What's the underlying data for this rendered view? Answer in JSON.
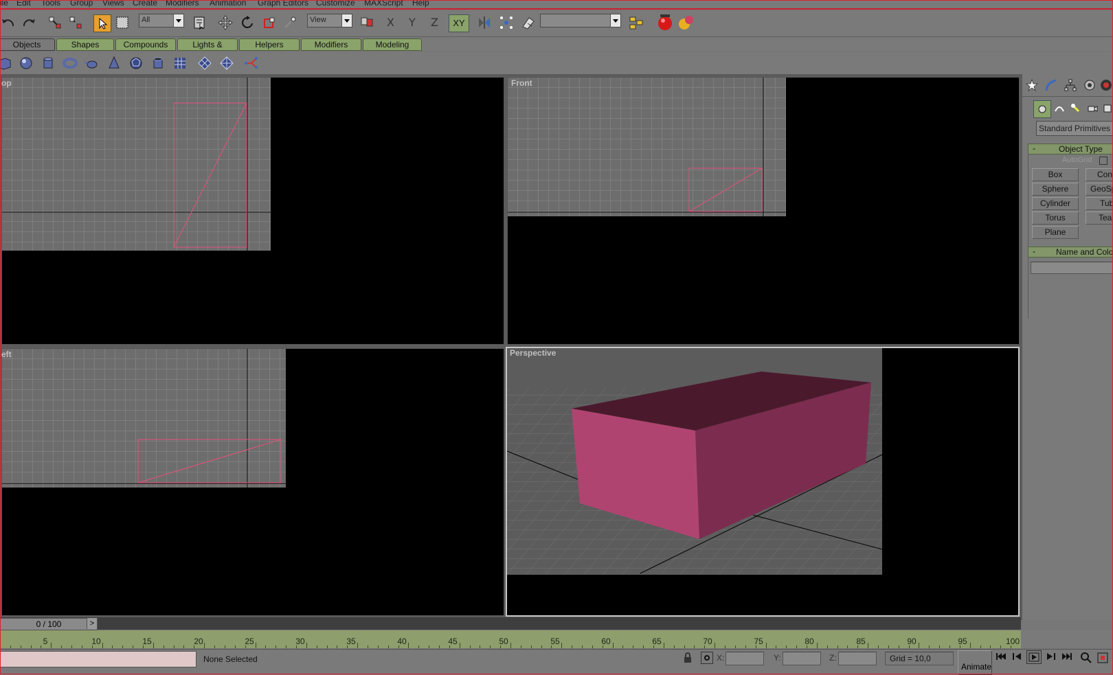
{
  "menu": [
    "ile",
    "Edit",
    "Tools",
    "Group",
    "Views",
    "Create",
    "Modifiers",
    "Animation",
    "Graph Editors",
    "Customize",
    "MAXScript",
    "Help"
  ],
  "toolbar": {
    "filter_value": "All",
    "coord_value": "View",
    "axis_x": "X",
    "axis_y": "Y",
    "axis_z": "Z",
    "axis_xy": "XY",
    "named_selection_value": ""
  },
  "tabs": [
    "Objects",
    "Shapes",
    "Compounds",
    "Lights & Cameras",
    "Helpers",
    "Modifiers",
    "Modeling"
  ],
  "viewports": {
    "top": "op",
    "front": "Front",
    "left": "eft",
    "perspective": "Perspective"
  },
  "command_panel": {
    "category": "Standard Primitives",
    "object_type_title": "Object Type",
    "autogrid": "AutoGrid",
    "buttons": [
      "Box",
      "Cone",
      "Sphere",
      "GeoSp",
      "Cylinder",
      "Tub",
      "Torus",
      "Teap",
      "Plane"
    ],
    "name_color_title": "Name and Color",
    "name_value": "",
    "collapse_glyph": "-"
  },
  "timeline": {
    "slider_label": "0 / 100",
    "ticks": [
      "5",
      "10",
      "15",
      "20",
      "25",
      "30",
      "35",
      "40",
      "45",
      "50",
      "55",
      "60",
      "65",
      "70",
      "75",
      "80",
      "85",
      "90",
      "95",
      "100"
    ]
  },
  "status": {
    "selection": "None Selected",
    "x_label": "X:",
    "y_label": "Y:",
    "z_label": "Z:",
    "x_value": "",
    "y_value": "",
    "z_value": "",
    "grid": "Grid = 10,0",
    "animate": "Animate"
  },
  "colors": {
    "accent_green": "#8aa36a",
    "object_wire": "#e8507a",
    "box_front": "#b04470",
    "box_side": "#7c2c4e",
    "box_top": "#4a1a2c",
    "frame_red": "#e0202a"
  }
}
